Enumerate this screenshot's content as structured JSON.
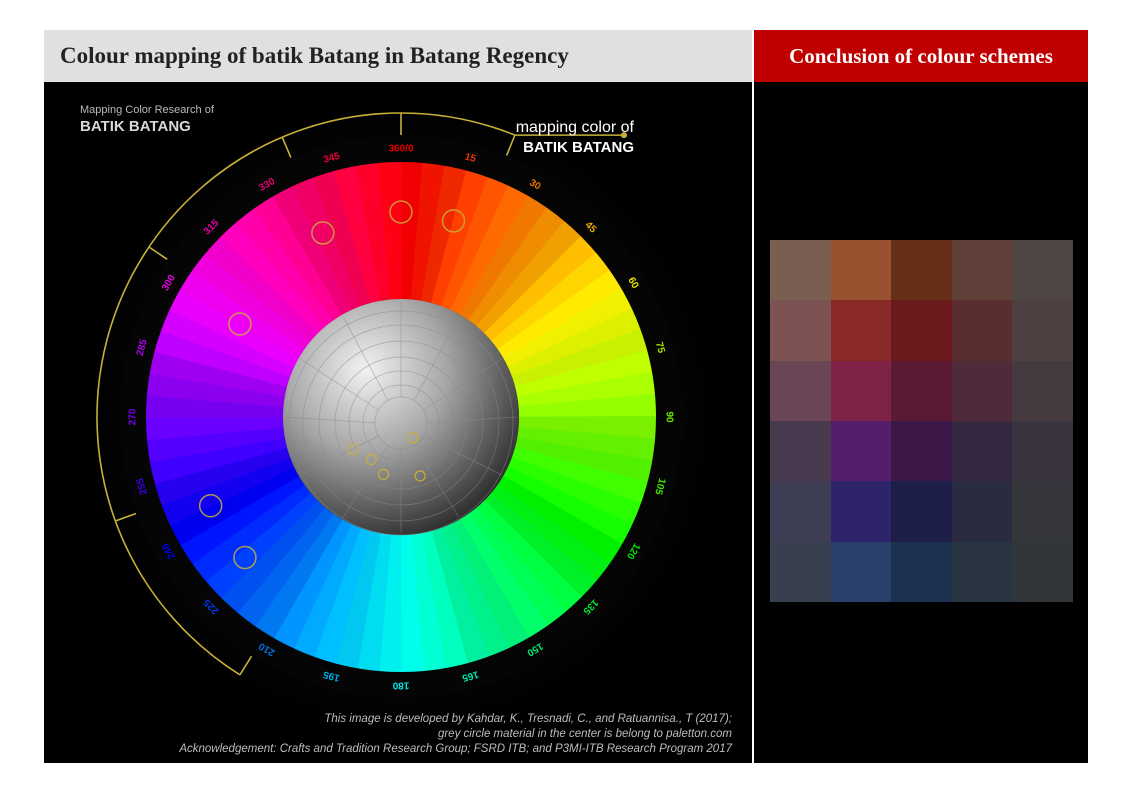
{
  "header": {
    "left_title": "Colour mapping of batik Batang in Batang Regency",
    "right_title": "Conclusion of colour schemes"
  },
  "wheel": {
    "research_title_small": "Mapping Color Research of",
    "research_title_big": "BATIK BATANG",
    "mapping_label_line1": "mapping color of",
    "mapping_label_line2": "BATIK BATANG",
    "degree_labels": [
      "360/0",
      "15",
      "30",
      "45",
      "60",
      "75",
      "90",
      "105",
      "120",
      "135",
      "150",
      "165",
      "180",
      "195",
      "210",
      "225",
      "240",
      "255",
      "270",
      "285",
      "300",
      "315",
      "330",
      "345"
    ],
    "credits": [
      "This image is developed by Kahdar, K., Tresnadi, C., and Ratuannisa., T (2017);",
      "grey circle material in the center is belong to paletton.com",
      "Acknowledgement: Crafts and Tradition Research Group; FSRD ITB; and P3MI-ITB Research Program 2017"
    ],
    "accent_color": "#c8b038"
  },
  "scheme_grid": {
    "colors": [
      [
        "#7a5e52",
        "#9a5130",
        "#663018",
        "#5e4038",
        "#4f4543"
      ],
      [
        "#7c5253",
        "#8a2a28",
        "#6a1a1a",
        "#5a2e30",
        "#4e3f40"
      ],
      [
        "#6a4555",
        "#7e2248",
        "#5a1a36",
        "#4f2a3a",
        "#453a40"
      ],
      [
        "#4a3a50",
        "#541e6a",
        "#3c1848",
        "#362840",
        "#3a3440"
      ],
      [
        "#3e3e55",
        "#2e246a",
        "#1e1e4a",
        "#2a2a40",
        "#35363c"
      ],
      [
        "#384050",
        "#28406a",
        "#1c3050",
        "#283440",
        "#30363a"
      ]
    ]
  }
}
